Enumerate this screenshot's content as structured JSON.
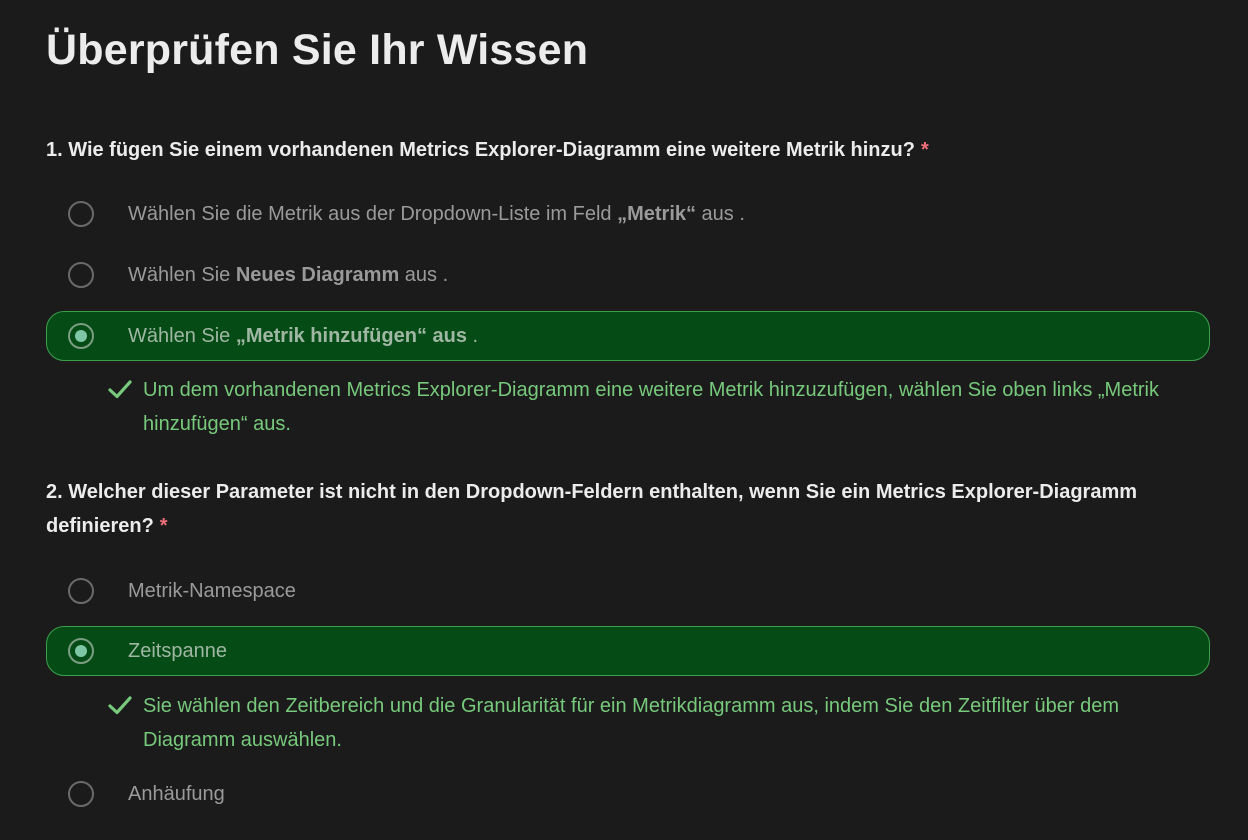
{
  "page": {
    "title": "Überprüfen Sie Ihr Wissen"
  },
  "colors": {
    "background": "#1b1b1b",
    "selected_option_bg": "#054b16",
    "selected_option_border": "#3b9f4c",
    "feedback_text": "#77c97c",
    "required_asterisk": "#f1707b"
  },
  "questions": [
    {
      "text": "1. Wie fügen Sie einem vorhandenen Metrics Explorer-Diagramm eine weitere Metrik hinzu?",
      "required_mark": "*",
      "options": [
        {
          "before": "Wählen Sie die Metrik aus der Dropdown-Liste im Feld ",
          "bold": "„Metrik“",
          "after": " aus .",
          "selected": false
        },
        {
          "before": "Wählen Sie ",
          "bold": "Neues Diagramm",
          "after": " aus .",
          "selected": false
        },
        {
          "before": "Wählen Sie ",
          "bold": "„Metrik hinzufügen“ aus",
          "after": " .",
          "selected": true
        }
      ],
      "feedback": {
        "icon": "checkmark-icon",
        "text": "Um dem vorhandenen Metrics Explorer-Diagramm eine weitere Metrik hinzuzufügen, wählen Sie oben links „Metrik hinzufügen“ aus."
      }
    },
    {
      "text": "2. Welcher dieser Parameter ist nicht in den Dropdown-Feldern enthalten, wenn Sie ein Metrics Explorer-Diagramm definieren?",
      "required_mark": "*",
      "options": [
        {
          "label": "Metrik-Namespace",
          "selected": false
        },
        {
          "label": "Zeitspanne",
          "selected": true
        },
        {
          "label": "Anhäufung",
          "selected": false
        }
      ],
      "feedback": {
        "icon": "checkmark-icon",
        "text": "Sie wählen den Zeitbereich und die Granularität für ein Metrikdiagramm aus, indem Sie den Zeitfilter über dem Diagramm auswählen."
      }
    }
  ]
}
